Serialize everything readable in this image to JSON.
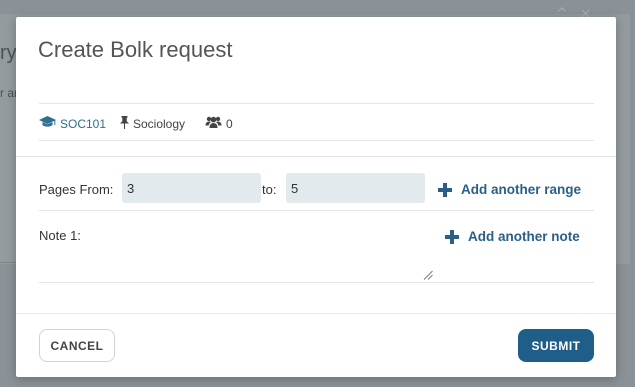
{
  "background": {
    "heading_fragment": "ry",
    "text_fragment": "r ar"
  },
  "modal": {
    "title": "Create Bolk request",
    "meta": {
      "course": "SOC101",
      "department": "Sociology",
      "members_count": "0"
    },
    "form": {
      "pages_from_label": "Pages From:",
      "pages_from_value": "3",
      "to_label": "to:",
      "pages_to_value": "5",
      "add_range_label": "Add another range",
      "note_label": "Note 1:",
      "note_value": "",
      "add_note_label": "Add another note"
    },
    "buttons": {
      "cancel": "CANCEL",
      "submit": "SUBMIT"
    }
  },
  "colors": {
    "accent": "#1f5e88",
    "link": "#2a5f87",
    "input_bg": "#e3eaee"
  },
  "icons": {
    "course": "graduation-cap-icon",
    "department": "pushpin-icon",
    "members": "users-icon",
    "add": "plus-icon"
  }
}
